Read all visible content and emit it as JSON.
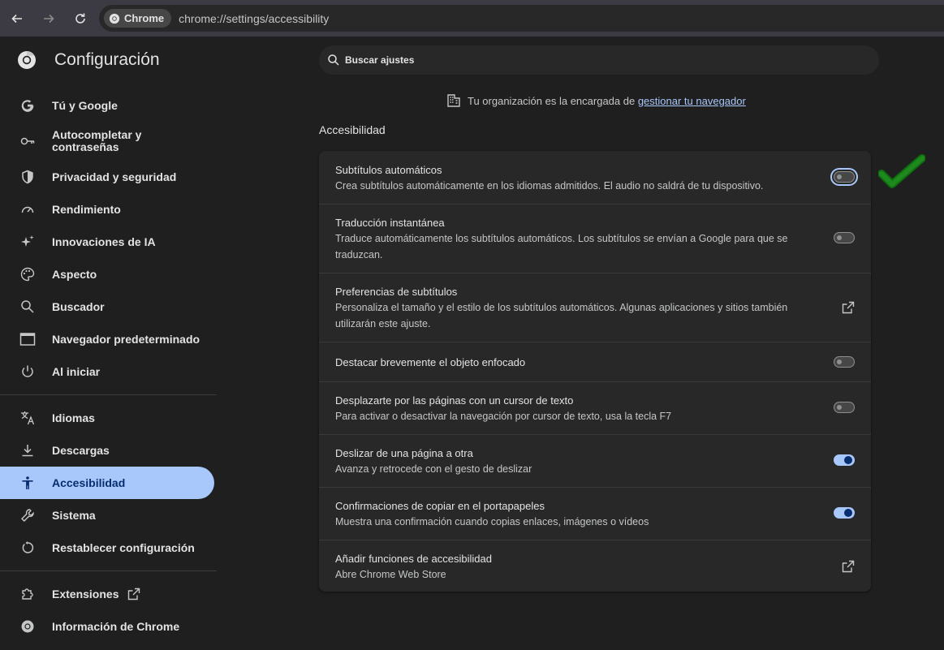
{
  "browser": {
    "chip_label": "Chrome",
    "url": "chrome://settings/accessibility"
  },
  "header": {
    "title": "Configuración"
  },
  "search": {
    "placeholder": "Buscar ajustes"
  },
  "org_note": {
    "text": "Tu organización es la encargada de ",
    "link": "gestionar tu navegador"
  },
  "sidebar": {
    "items": [
      {
        "label": "Tú y Google",
        "icon": "google-g-icon"
      },
      {
        "label": "Autocompletar y contraseñas",
        "icon": "key-icon"
      },
      {
        "label": "Privacidad y seguridad",
        "icon": "shield-icon"
      },
      {
        "label": "Rendimiento",
        "icon": "gauge-icon"
      },
      {
        "label": "Innovaciones de IA",
        "icon": "sparkle-icon"
      },
      {
        "label": "Aspecto",
        "icon": "palette-icon"
      },
      {
        "label": "Buscador",
        "icon": "search-icon"
      },
      {
        "label": "Navegador predeterminado",
        "icon": "browser-window-icon"
      },
      {
        "label": "Al iniciar",
        "icon": "power-icon"
      },
      {
        "label": "Idiomas",
        "icon": "translate-icon"
      },
      {
        "label": "Descargas",
        "icon": "download-icon"
      },
      {
        "label": "Accesibilidad",
        "icon": "accessibility-icon",
        "active": true
      },
      {
        "label": "Sistema",
        "icon": "wrench-icon"
      },
      {
        "label": "Restablecer configuración",
        "icon": "reset-icon"
      },
      {
        "label": "Extensiones",
        "icon": "puzzle-icon"
      },
      {
        "label": "Información de Chrome",
        "icon": "chrome-icon"
      }
    ]
  },
  "main": {
    "section_title": "Accesibilidad",
    "rows": [
      {
        "title": "Subtítulos automáticos",
        "desc": "Crea subtítulos automáticamente en los idiomas admitidos. El audio no saldrá de tu dispositivo.",
        "control": "toggle",
        "state": "off"
      },
      {
        "title": "Traducción instantánea",
        "desc": "Traduce automáticamente los subtítulos automáticos. Los subtítulos se envían a Google para que se traduzcan.",
        "control": "toggle",
        "state": "off"
      },
      {
        "title": "Preferencias de subtítulos",
        "desc": "Personaliza el tamaño y el estilo de los subtítulos automáticos. Algunas aplicaciones y sitios también utilizarán este ajuste.",
        "control": "external-link"
      },
      {
        "title": "Destacar brevemente el objeto enfocado",
        "desc": "",
        "control": "toggle",
        "state": "off"
      },
      {
        "title": "Desplazarte por las páginas con un cursor de texto",
        "desc": "Para activar o desactivar la navegación por cursor de texto, usa la tecla F7",
        "control": "toggle",
        "state": "off"
      },
      {
        "title": "Deslizar de una página a otra",
        "desc": "Avanza y retrocede con el gesto de deslizar",
        "control": "toggle",
        "state": "on"
      },
      {
        "title": "Confirmaciones de copiar en el portapapeles",
        "desc": "Muestra una confirmación cuando copias enlaces, imágenes o vídeos",
        "control": "toggle",
        "state": "on"
      },
      {
        "title": "Añadir funciones de accesibilidad",
        "desc": "Abre Chrome Web Store",
        "control": "external-link"
      }
    ]
  },
  "colors": {
    "accent": "#a8c7fa",
    "background": "#1f1f1f",
    "card": "#282828",
    "checkmark": "#1e8a1e"
  }
}
